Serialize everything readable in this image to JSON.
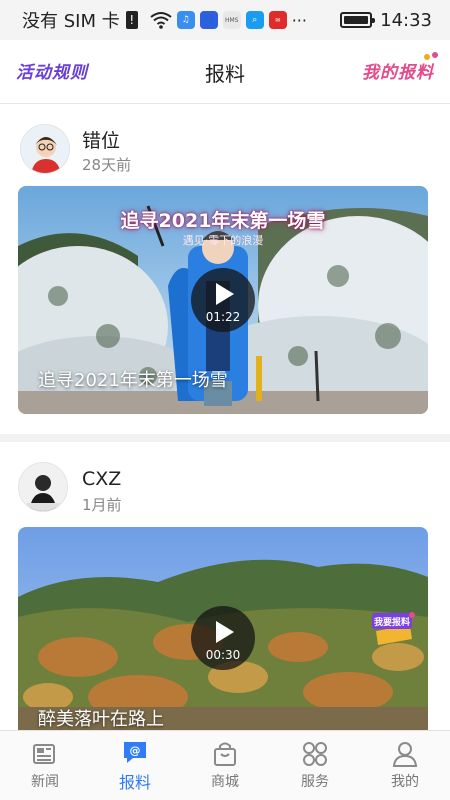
{
  "status_bar": {
    "carrier": "没有 SIM 卡",
    "time": "14:33",
    "more": "···"
  },
  "header": {
    "left_link": "活动规则",
    "title": "报料",
    "right_link": "我的报料"
  },
  "posts": [
    {
      "author": "错位",
      "time": "28天前",
      "overlay_title": "追寻2021年末第一场雪",
      "overlay_sub": "遇见·零下的浪漫",
      "duration": "01:22",
      "caption": "追寻2021年末第一场雪"
    },
    {
      "author": "CXZ",
      "time": "1月前",
      "badge_text": "我要报料",
      "duration": "00:30",
      "caption": "醉美落叶在路上"
    }
  ],
  "nav": {
    "items": [
      {
        "label": "新闻",
        "icon": "newspaper-icon"
      },
      {
        "label": "报料",
        "icon": "report-icon",
        "active": true
      },
      {
        "label": "商城",
        "icon": "shopping-bag-icon"
      },
      {
        "label": "服务",
        "icon": "service-grid-icon"
      },
      {
        "label": "我的",
        "icon": "person-icon"
      }
    ]
  },
  "colors": {
    "accent": "#2f7cf6",
    "rule_link": "#6a3fd3",
    "my_report_link": "#e24b8c"
  }
}
